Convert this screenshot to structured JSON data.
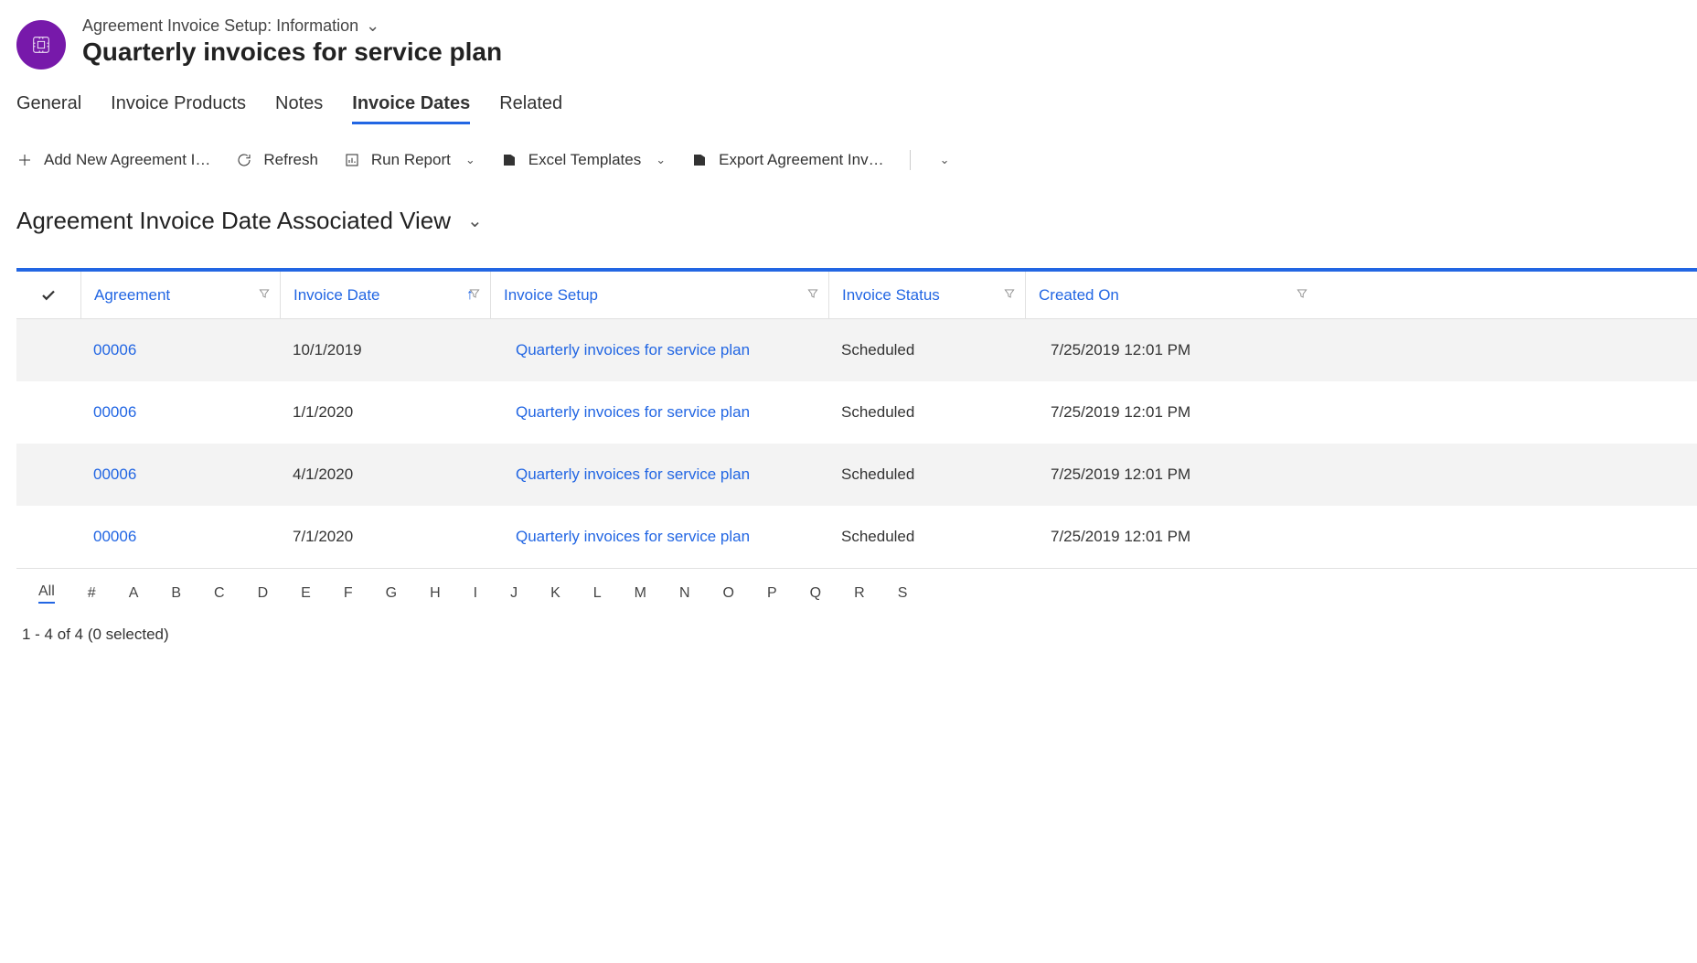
{
  "header": {
    "breadcrumb": "Agreement Invoice Setup: Information",
    "title": "Quarterly invoices for service plan"
  },
  "tabs": [
    {
      "label": "General",
      "active": false
    },
    {
      "label": "Invoice Products",
      "active": false
    },
    {
      "label": "Notes",
      "active": false
    },
    {
      "label": "Invoice Dates",
      "active": true
    },
    {
      "label": "Related",
      "active": false
    }
  ],
  "cmdbar": {
    "add": "Add New Agreement I…",
    "refresh": "Refresh",
    "run_report": "Run Report",
    "excel_tpl": "Excel Templates",
    "export": "Export Agreement Inv…"
  },
  "view": {
    "title": "Agreement Invoice Date Associated View"
  },
  "columns": {
    "agreement": "Agreement",
    "invoice_date": "Invoice Date",
    "invoice_setup": "Invoice Setup",
    "invoice_status": "Invoice Status",
    "created_on": "Created On"
  },
  "rows": [
    {
      "agreement": "00006",
      "date": "10/1/2019",
      "setup": "Quarterly invoices for service plan",
      "status": "Scheduled",
      "created": "7/25/2019 12:01 PM"
    },
    {
      "agreement": "00006",
      "date": "1/1/2020",
      "setup": "Quarterly invoices for service plan",
      "status": "Scheduled",
      "created": "7/25/2019 12:01 PM"
    },
    {
      "agreement": "00006",
      "date": "4/1/2020",
      "setup": "Quarterly invoices for service plan",
      "status": "Scheduled",
      "created": "7/25/2019 12:01 PM"
    },
    {
      "agreement": "00006",
      "date": "7/1/2020",
      "setup": "Quarterly invoices for service plan",
      "status": "Scheduled",
      "created": "7/25/2019 12:01 PM"
    }
  ],
  "alpha": [
    "All",
    "#",
    "A",
    "B",
    "C",
    "D",
    "E",
    "F",
    "G",
    "H",
    "I",
    "J",
    "K",
    "L",
    "M",
    "N",
    "O",
    "P",
    "Q",
    "R",
    "S"
  ],
  "footer": {
    "status": "1 - 4 of 4 (0 selected)"
  }
}
